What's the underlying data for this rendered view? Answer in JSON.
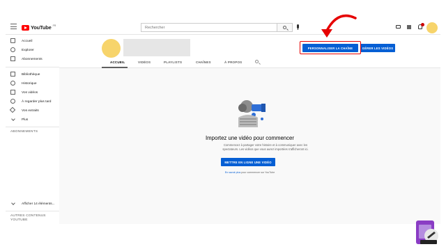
{
  "header": {
    "logo_text": "YouTube",
    "logo_sup": "FR",
    "search_placeholder": "Rechercher"
  },
  "sidebar": {
    "items": [
      {
        "label": "Accueil",
        "icon": "home-icon"
      },
      {
        "label": "Explorer",
        "icon": "explore-icon"
      },
      {
        "label": "Abonnements",
        "icon": "subscriptions-icon"
      }
    ],
    "library": [
      {
        "label": "Bibliothèque",
        "icon": "library-icon"
      },
      {
        "label": "Historique",
        "icon": "history-icon"
      },
      {
        "label": "Vos vidéos",
        "icon": "your-videos-icon"
      },
      {
        "label": "À regarder plus tard",
        "icon": "watch-later-icon"
      },
      {
        "label": "Vos extraits",
        "icon": "clips-icon"
      },
      {
        "label": "Plus",
        "icon": "chevron-down-icon"
      }
    ],
    "subscriptions_title": "ABONNEMENTS",
    "show_more_label": "Afficher 14 éléments...",
    "more_content_title": "AUTRES CONTENUS YOUTUBE"
  },
  "channel": {
    "customize_label": "PERSONNALISER LA CHAÎNE",
    "manage_label": "GÉRER LES VIDÉOS",
    "tabs": [
      {
        "label": "ACCUEIL",
        "active": true
      },
      {
        "label": "VIDÉOS",
        "active": false
      },
      {
        "label": "PLAYLISTS",
        "active": false
      },
      {
        "label": "CHAÎNES",
        "active": false
      },
      {
        "label": "À PROPOS",
        "active": false
      }
    ]
  },
  "empty_state": {
    "title": "Importez une vidéo pour commencer",
    "description": "Commencez à partager votre histoire et à communiquer avec les spectateurs. Les vidéos que vous aurez importées s'afficheront ici.",
    "upload_label": "METTRE EN LIGNE UNE VIDÉO",
    "link_text": "En savoir plus",
    "link_suffix": " pour commencer sur YouTube"
  },
  "colors": {
    "brand_red": "#ff0000",
    "button_blue": "#065fd4",
    "avatar_yellow": "#f7d46b",
    "annotation_red": "#e60000"
  }
}
